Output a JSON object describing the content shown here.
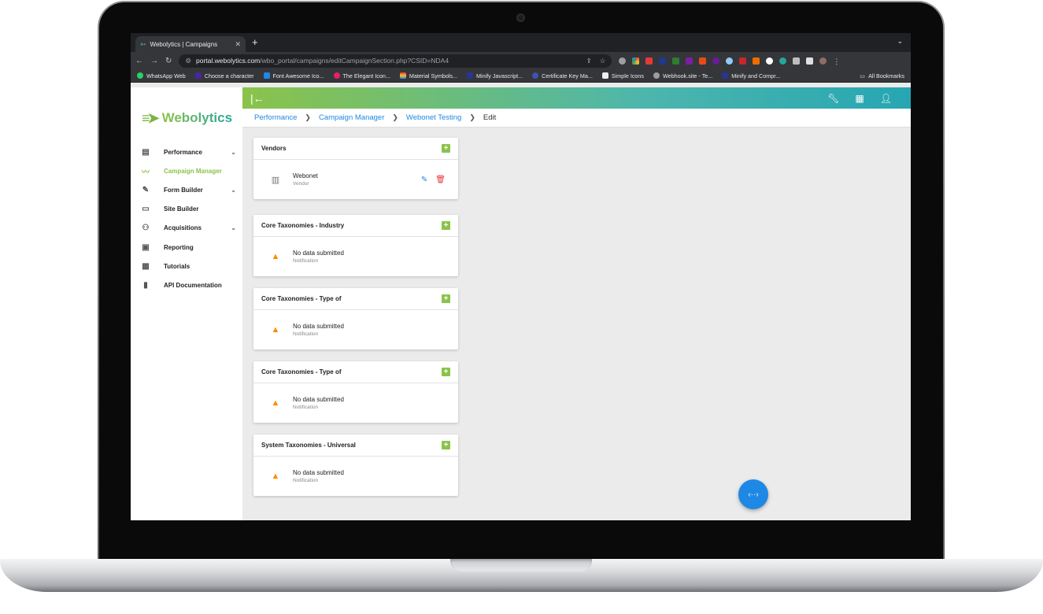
{
  "browser": {
    "tab_title": "Webolytics | Campaigns",
    "url_host": "portal.webolytics.com",
    "url_path": "/wbo_portal/campaigns/editCampaignSection.php?CSID=NDA4",
    "bookmarks": [
      "WhatsApp Web",
      "Choose a character",
      "Font Awesome Ico...",
      "The Elegant Icon...",
      "Material Symbols...",
      "Minify Javascript...",
      "Certificate Key Ma...",
      "Simple Icons",
      "Webhook.site - Te...",
      "Minify and Compr..."
    ],
    "all_bookmarks": "All Bookmarks"
  },
  "app": {
    "logo_text": "Webolytics",
    "nav": [
      {
        "label": "Performance",
        "icon": "dashboard-icon",
        "chevron": true,
        "active": false
      },
      {
        "label": "Campaign Manager",
        "icon": "trend-icon",
        "chevron": false,
        "active": true
      },
      {
        "label": "Form Builder",
        "icon": "form-icon",
        "chevron": true,
        "active": false
      },
      {
        "label": "Site Builder",
        "icon": "web-icon",
        "chevron": false,
        "active": false
      },
      {
        "label": "Acquisitions",
        "icon": "people-icon",
        "chevron": true,
        "active": false
      },
      {
        "label": "Reporting",
        "icon": "archive-icon",
        "chevron": false,
        "active": false
      },
      {
        "label": "Tutorials",
        "icon": "video-icon",
        "chevron": false,
        "active": false
      },
      {
        "label": "API Documentation",
        "icon": "book-icon",
        "chevron": false,
        "active": false
      }
    ],
    "breadcrumb": {
      "b1": "Performance",
      "b2": "Campaign Manager",
      "b3": "Webonet Testing",
      "b4": "Edit"
    },
    "cards": [
      {
        "title": "Vendors",
        "item": "Webonet",
        "sub": "Vendor",
        "type": "vendor"
      },
      {
        "title": "Core Taxonomies - Industry",
        "item": "No data submitted",
        "sub": "Notification",
        "type": "empty"
      },
      {
        "title": "Core Taxonomies - Type of",
        "item": "No data submitted",
        "sub": "Notification",
        "type": "empty"
      },
      {
        "title": "Core Taxonomies - Type of",
        "item": "No data submitted",
        "sub": "Notification",
        "type": "empty"
      },
      {
        "title": "System Taxonomies - Universal",
        "item": "No data submitted",
        "sub": "Notification",
        "type": "empty"
      }
    ]
  },
  "colors": {
    "accent_green": "#8bc34a",
    "link_blue": "#1e88e5",
    "warning": "#fb8c00",
    "delete_red": "#e53935"
  }
}
